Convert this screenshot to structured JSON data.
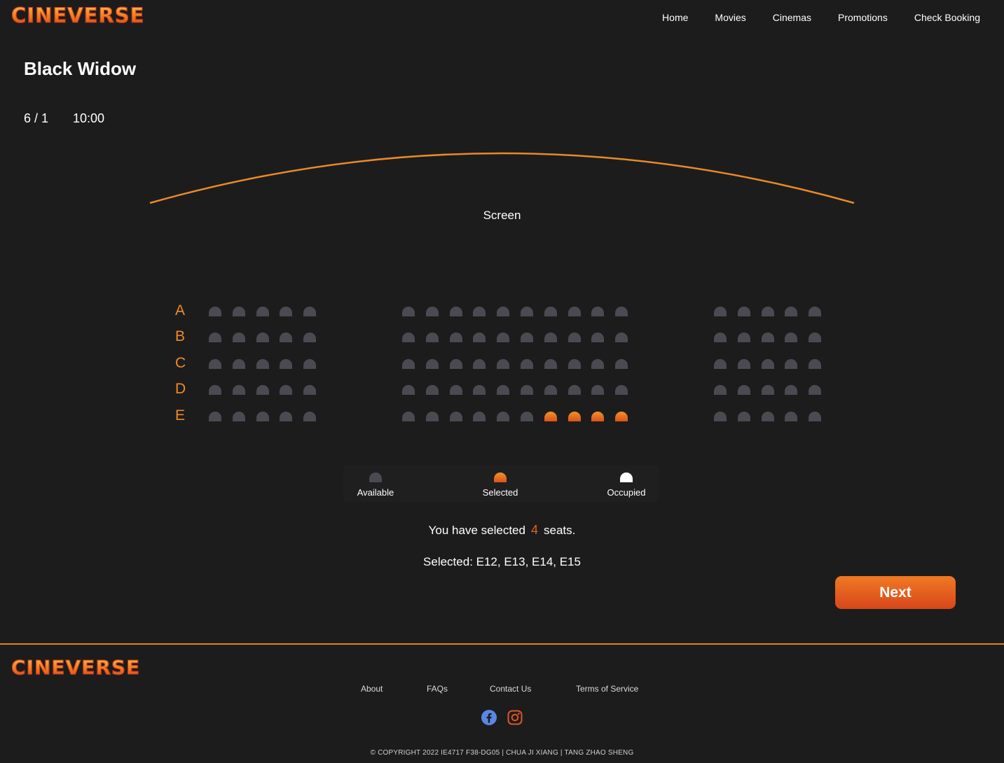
{
  "brand": "CINEVERSE",
  "nav": [
    "Home",
    "Movies",
    "Cinemas",
    "Promotions",
    "Check Booking"
  ],
  "movie": {
    "title": "Black Widow",
    "date": "6 / 1",
    "time": "10:00"
  },
  "screen_label": "Screen",
  "seat_map": {
    "rows": [
      "A",
      "B",
      "C",
      "D",
      "E"
    ],
    "sections": [
      5,
      10,
      5
    ],
    "selected": [
      "E12",
      "E13",
      "E14",
      "E15"
    ],
    "occupied": []
  },
  "legend": {
    "available": "Available",
    "selected": "Selected",
    "occupied": "Occupied"
  },
  "summary": {
    "prefix": "You have selected",
    "count": "4",
    "suffix": "seats.",
    "selected_text": "Selected: E12, E13, E14, E15"
  },
  "next_label": "Next",
  "footer": {
    "brand": "CINEVERSE",
    "links": [
      "About",
      "FAQs",
      "Contact Us",
      "Terms of Service"
    ],
    "social": [
      "facebook-icon",
      "instagram-icon"
    ],
    "copyright": "© COPYRIGHT 2022 IE4717 F38-DG05 | CHUA JI XIANG | TANG ZHAO SHENG"
  },
  "colors": {
    "accent": "#f08a24",
    "available_seat": "#4b4a52",
    "selected_seat": "#e0641f",
    "occupied_seat": "#ffffff",
    "background": "#1c1c1c"
  }
}
